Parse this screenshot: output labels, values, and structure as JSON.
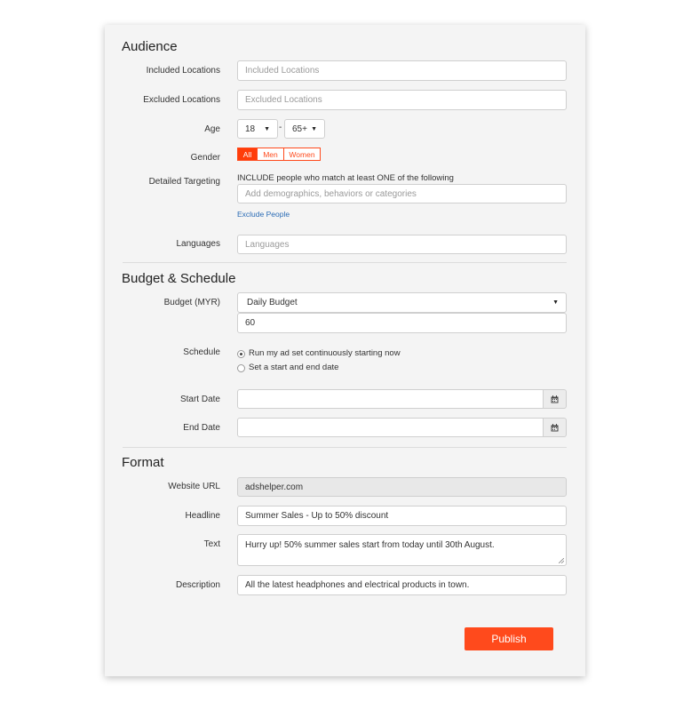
{
  "audience": {
    "heading": "Audience",
    "included_locations": {
      "label": "Included Locations",
      "placeholder": "Included Locations"
    },
    "excluded_locations": {
      "label": "Excluded Locations",
      "placeholder": "Excluded Locations"
    },
    "age": {
      "label": "Age",
      "min": "18",
      "separator": "-",
      "max": "65+"
    },
    "gender": {
      "label": "Gender",
      "options": [
        "All",
        "Men",
        "Women"
      ],
      "selected": "All"
    },
    "detailed_targeting": {
      "label": "Detailed Targeting",
      "hint": "INCLUDE people who match at least ONE of the following",
      "placeholder": "Add demographics, behaviors or categories",
      "exclude_link": "Exclude People"
    },
    "languages": {
      "label": "Languages",
      "placeholder": "Languages"
    }
  },
  "budget_schedule": {
    "heading": "Budget & Schedule",
    "budget": {
      "label": "Budget (MYR)",
      "type": "Daily Budget",
      "amount": "60"
    },
    "schedule": {
      "label": "Schedule",
      "options": [
        "Run my ad set continuously starting now",
        "Set a start and end date"
      ],
      "selected": "Run my ad set continuously starting now"
    },
    "start_date": {
      "label": "Start Date",
      "value": ""
    },
    "end_date": {
      "label": "End Date",
      "value": ""
    }
  },
  "format": {
    "heading": "Format",
    "website_url": {
      "label": "Website URL",
      "value": "adshelper.com"
    },
    "headline": {
      "label": "Headline",
      "value": "Summer Sales - Up to 50% discount"
    },
    "text": {
      "label": "Text",
      "value": "Hurry up! 50% summer sales start from today until 30th August."
    },
    "description": {
      "label": "Description",
      "value": "All the latest headphones and electrical products in town."
    }
  },
  "actions": {
    "publish_label": "Publish"
  },
  "colors": {
    "accent": "#ff4a1c",
    "link": "#2a6bb5",
    "card_bg": "#f4f4f4"
  },
  "icons": {
    "calendar": "calendar-icon",
    "caret": "caret-down-icon",
    "resize": "resize-handle-icon"
  }
}
